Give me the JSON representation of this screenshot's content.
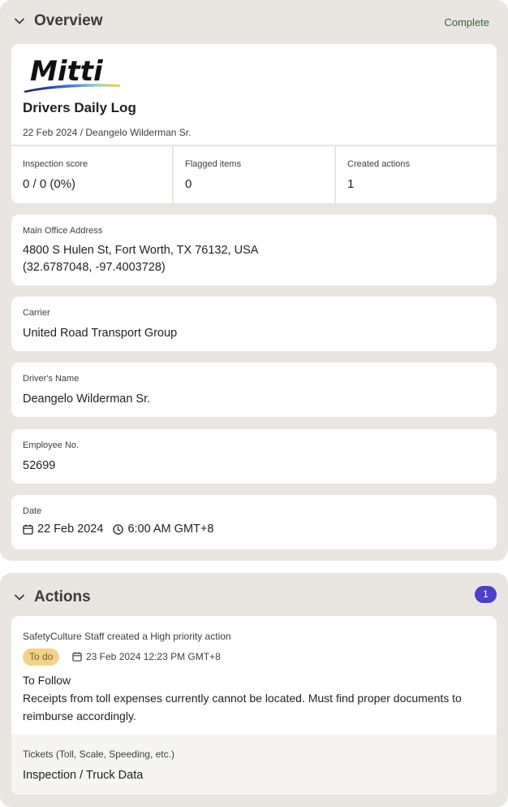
{
  "overview": {
    "title": "Overview",
    "status": "Complete",
    "header": {
      "logo_text": "Mitti",
      "doc_title": "Drivers Daily Log",
      "subtitle": "22 Feb 2024 / Deangelo Wilderman Sr."
    },
    "stats": [
      {
        "label": "Inspection score",
        "value": "0 / 0 (0%)"
      },
      {
        "label": "Flagged items",
        "value": "0"
      },
      {
        "label": "Created actions",
        "value": "1"
      }
    ],
    "address": {
      "label": "Main Office Address",
      "line1": "4800 S Hulen St, Fort Worth, TX 76132, USA",
      "line2": "(32.6787048, -97.4003728)"
    },
    "carrier": {
      "label": "Carrier",
      "value": "United Road Transport Group"
    },
    "driver": {
      "label": "Driver's Name",
      "value": "Deangelo Wilderman Sr."
    },
    "employee": {
      "label": "Employee No.",
      "value": "52699"
    },
    "date": {
      "label": "Date",
      "date_value": "22 Feb 2024",
      "time_value": "6:00 AM GMT+8"
    }
  },
  "actions": {
    "title": "Actions",
    "count": "1",
    "item": {
      "meta": "SafetyCulture Staff created a High priority action",
      "status": "To do",
      "due": "23 Feb 2024 12:23 PM GMT+8",
      "title": "To Follow",
      "description": "Receipts from toll expenses currently cannot be located. Must find proper documents to reimburse accordingly.",
      "footer_label": "Tickets (Toll, Scale, Speeding, etc.)",
      "footer_value": "Inspection / Truck Data"
    }
  },
  "icons": {
    "collapse": "chevron-down-icon",
    "calendar": "calendar-icon",
    "clock": "clock-icon"
  },
  "colors": {
    "section_bg": "#e9e6e1",
    "complete": "#3a5f3a",
    "count_badge": "#4a40c9",
    "todo_badge": "#f3d28b"
  }
}
